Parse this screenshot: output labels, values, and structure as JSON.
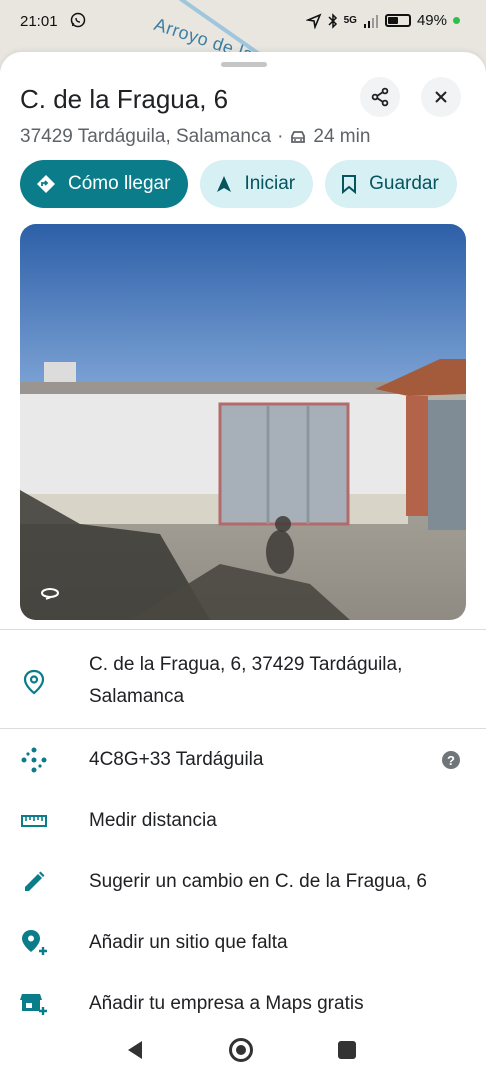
{
  "status": {
    "time": "21:01",
    "network": "5G",
    "battery": "49%",
    "battery_level": 0.49
  },
  "map": {
    "label": "Arroyo de la Quedaña"
  },
  "place": {
    "title": "C. de la Fragua, 6",
    "address_short": "37429 Tardáguila, Salamanca",
    "separator": "·",
    "drive_time": "24 min"
  },
  "actions": {
    "directions": "Cómo llegar",
    "start": "Iniciar",
    "save": "Guardar"
  },
  "details": {
    "address_line1": "C. de la Fragua, 6, 37429 Tardáguila,",
    "address_line2": "Salamanca",
    "plus_code": "4C8G+33 Tardáguila",
    "measure": "Medir distancia",
    "suggest_edit": "Sugerir un cambio en C. de la Fragua, 6",
    "add_place": "Añadir un sitio que falta",
    "add_business": "Añadir tu empresa a Maps gratis"
  },
  "icons": {
    "share": "share-icon",
    "close": "close-icon",
    "car": "car-icon",
    "directions": "directions-diamond-icon",
    "navigate": "navigation-arrow-icon",
    "bookmark": "bookmark-icon",
    "pin": "location-pin-icon",
    "plus_code": "plus-code-icon",
    "ruler": "ruler-icon",
    "pencil": "pencil-icon",
    "add_place": "add-location-icon",
    "add_business": "add-business-icon",
    "help": "help-icon"
  },
  "colors": {
    "accent": "#0b7c8a",
    "chip_light": "#d6f0f4",
    "text_primary": "#202124",
    "text_secondary": "#5f6368"
  }
}
